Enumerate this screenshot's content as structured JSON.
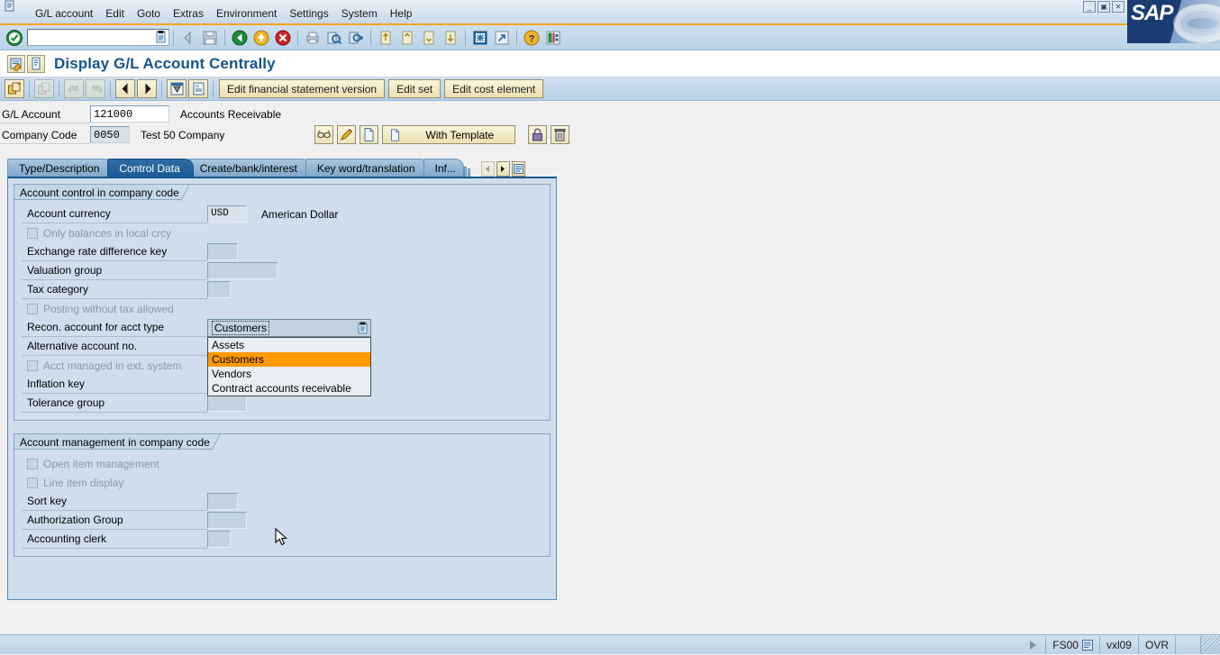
{
  "window": {
    "minimize_label": "_",
    "restore_label": "▣",
    "close_label": "✕",
    "brand": "SAP"
  },
  "menubar": {
    "items": [
      {
        "label": "G/L account"
      },
      {
        "label": "Edit"
      },
      {
        "label": "Goto"
      },
      {
        "label": "Extras"
      },
      {
        "label": "Environment"
      },
      {
        "label": "Settings"
      },
      {
        "label": "System"
      },
      {
        "label": "Help"
      }
    ]
  },
  "command": {
    "value": "",
    "placeholder": ""
  },
  "system_toolbar": {
    "icons": [
      "enter-ok-icon",
      "back-arrow-icon",
      "save-icon",
      "back-green-icon",
      "exit-yellow-icon",
      "cancel-red-icon",
      "print-icon",
      "find-icon",
      "find-next-icon",
      "first-page-icon",
      "previous-page-icon",
      "next-page-icon",
      "last-page-icon",
      "create-session-icon",
      "create-shortcut-icon",
      "help-icon",
      "customize-layout-icon"
    ]
  },
  "title": {
    "text": "Display G/L Account Centrally"
  },
  "app_toolbar": {
    "buttons": [
      {
        "label": "Edit financial statement version"
      },
      {
        "label": "Edit set"
      },
      {
        "label": "Edit cost element"
      }
    ],
    "icons": [
      "other-gl-account-icon",
      "display-change-icon",
      "previous-account-icon",
      "next-account-icon",
      "back-account-icon",
      "forward-account-icon",
      "print-account-icon",
      "notes-icon"
    ]
  },
  "header": {
    "gl_account_label": "G/L Account",
    "gl_account_value": "121000",
    "gl_account_desc": "Accounts Receivable",
    "company_code_label": "Company Code",
    "company_code_value": "0050",
    "company_code_desc": "Test 50 Company",
    "with_template_label": "With Template",
    "action_icons": [
      "display-icon",
      "change-icon",
      "create-icon",
      "lock-icon",
      "delete-icon"
    ]
  },
  "tabs": [
    {
      "label": "Type/Description",
      "active": false
    },
    {
      "label": "Control Data",
      "active": true
    },
    {
      "label": "Create/bank/interest",
      "active": false
    },
    {
      "label": "Key word/translation",
      "active": false
    },
    {
      "label": "Inf...",
      "active": false
    }
  ],
  "groups": [
    {
      "title": "Account control in company code",
      "rows": [
        {
          "type": "field",
          "label": "Account currency",
          "value": "USD",
          "size": "md",
          "desc": "American Dollar",
          "readonly": true
        },
        {
          "type": "checkbox",
          "label": "Only balances in local crcy",
          "checked": false,
          "disabled": true
        },
        {
          "type": "field",
          "label": "Exchange rate difference key",
          "value": "",
          "size": "sm",
          "desc": ""
        },
        {
          "type": "field",
          "label": "Valuation group",
          "value": "",
          "size": "lg",
          "desc": ""
        },
        {
          "type": "field",
          "label": "Tax category",
          "value": "",
          "size": "xs",
          "desc": ""
        },
        {
          "type": "checkbox",
          "label": "Posting without tax allowed",
          "checked": false,
          "disabled": true
        },
        {
          "type": "combo",
          "label": "Recon. account for acct type",
          "value": "Customers"
        },
        {
          "type": "field",
          "label": "Alternative account no.",
          "value": "",
          "size": "xl",
          "desc": ""
        },
        {
          "type": "checkbox",
          "label": "Acct managed in ext. system",
          "checked": false,
          "disabled": true
        },
        {
          "type": "field",
          "label": "Inflation key",
          "value": "",
          "size": "sm",
          "desc": ""
        },
        {
          "type": "field",
          "label": "Tolerance group",
          "value": "",
          "size": "md",
          "desc": ""
        }
      ]
    },
    {
      "title": "Account management in company code",
      "rows": [
        {
          "type": "checkbox",
          "label": "Open item management",
          "checked": false,
          "disabled": true
        },
        {
          "type": "checkbox",
          "label": "Line item display",
          "checked": false,
          "disabled": true
        },
        {
          "type": "field",
          "label": "Sort key",
          "value": "",
          "size": "sm",
          "desc": ""
        },
        {
          "type": "field",
          "label": "Authorization Group",
          "value": "",
          "size": "md",
          "desc": ""
        },
        {
          "type": "field",
          "label": "Accounting clerk",
          "value": "",
          "size": "xs",
          "desc": ""
        }
      ]
    }
  ],
  "dropdown": {
    "open": true,
    "selected": "Customers",
    "options": [
      "Assets",
      "Customers",
      "Vendors",
      "Contract accounts receivable"
    ]
  },
  "statusbar": {
    "message": "",
    "transaction_code": "FS00",
    "system": "vxl09",
    "input_mode": "OVR"
  },
  "colors": {
    "accent_orange": "#ff9900",
    "title_blue": "#15558c",
    "panel_blue": "#cfdded",
    "toolbar_blue": "#bad2e6",
    "button_beige": "#ecdfb0"
  }
}
